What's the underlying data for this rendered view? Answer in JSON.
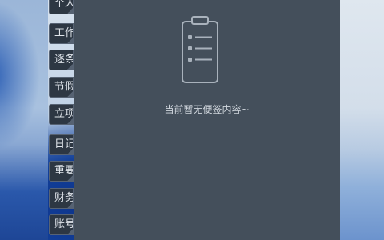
{
  "tabs": [
    {
      "label": "个人"
    },
    {
      "label": "工作"
    },
    {
      "label": "逐条"
    },
    {
      "label": "节假"
    },
    {
      "label": "立项"
    },
    {
      "label": "日记"
    },
    {
      "label": "重要"
    },
    {
      "label": "财务"
    },
    {
      "label": "账号"
    }
  ],
  "panel": {
    "empty_icon": "clipboard-list-icon",
    "empty_text": "当前暂无便签内容~"
  },
  "colors": {
    "panel_bg": "#444f5b",
    "tab_bg": "#2d3743",
    "tab_border": "#576374",
    "text": "#d0d6dd"
  }
}
